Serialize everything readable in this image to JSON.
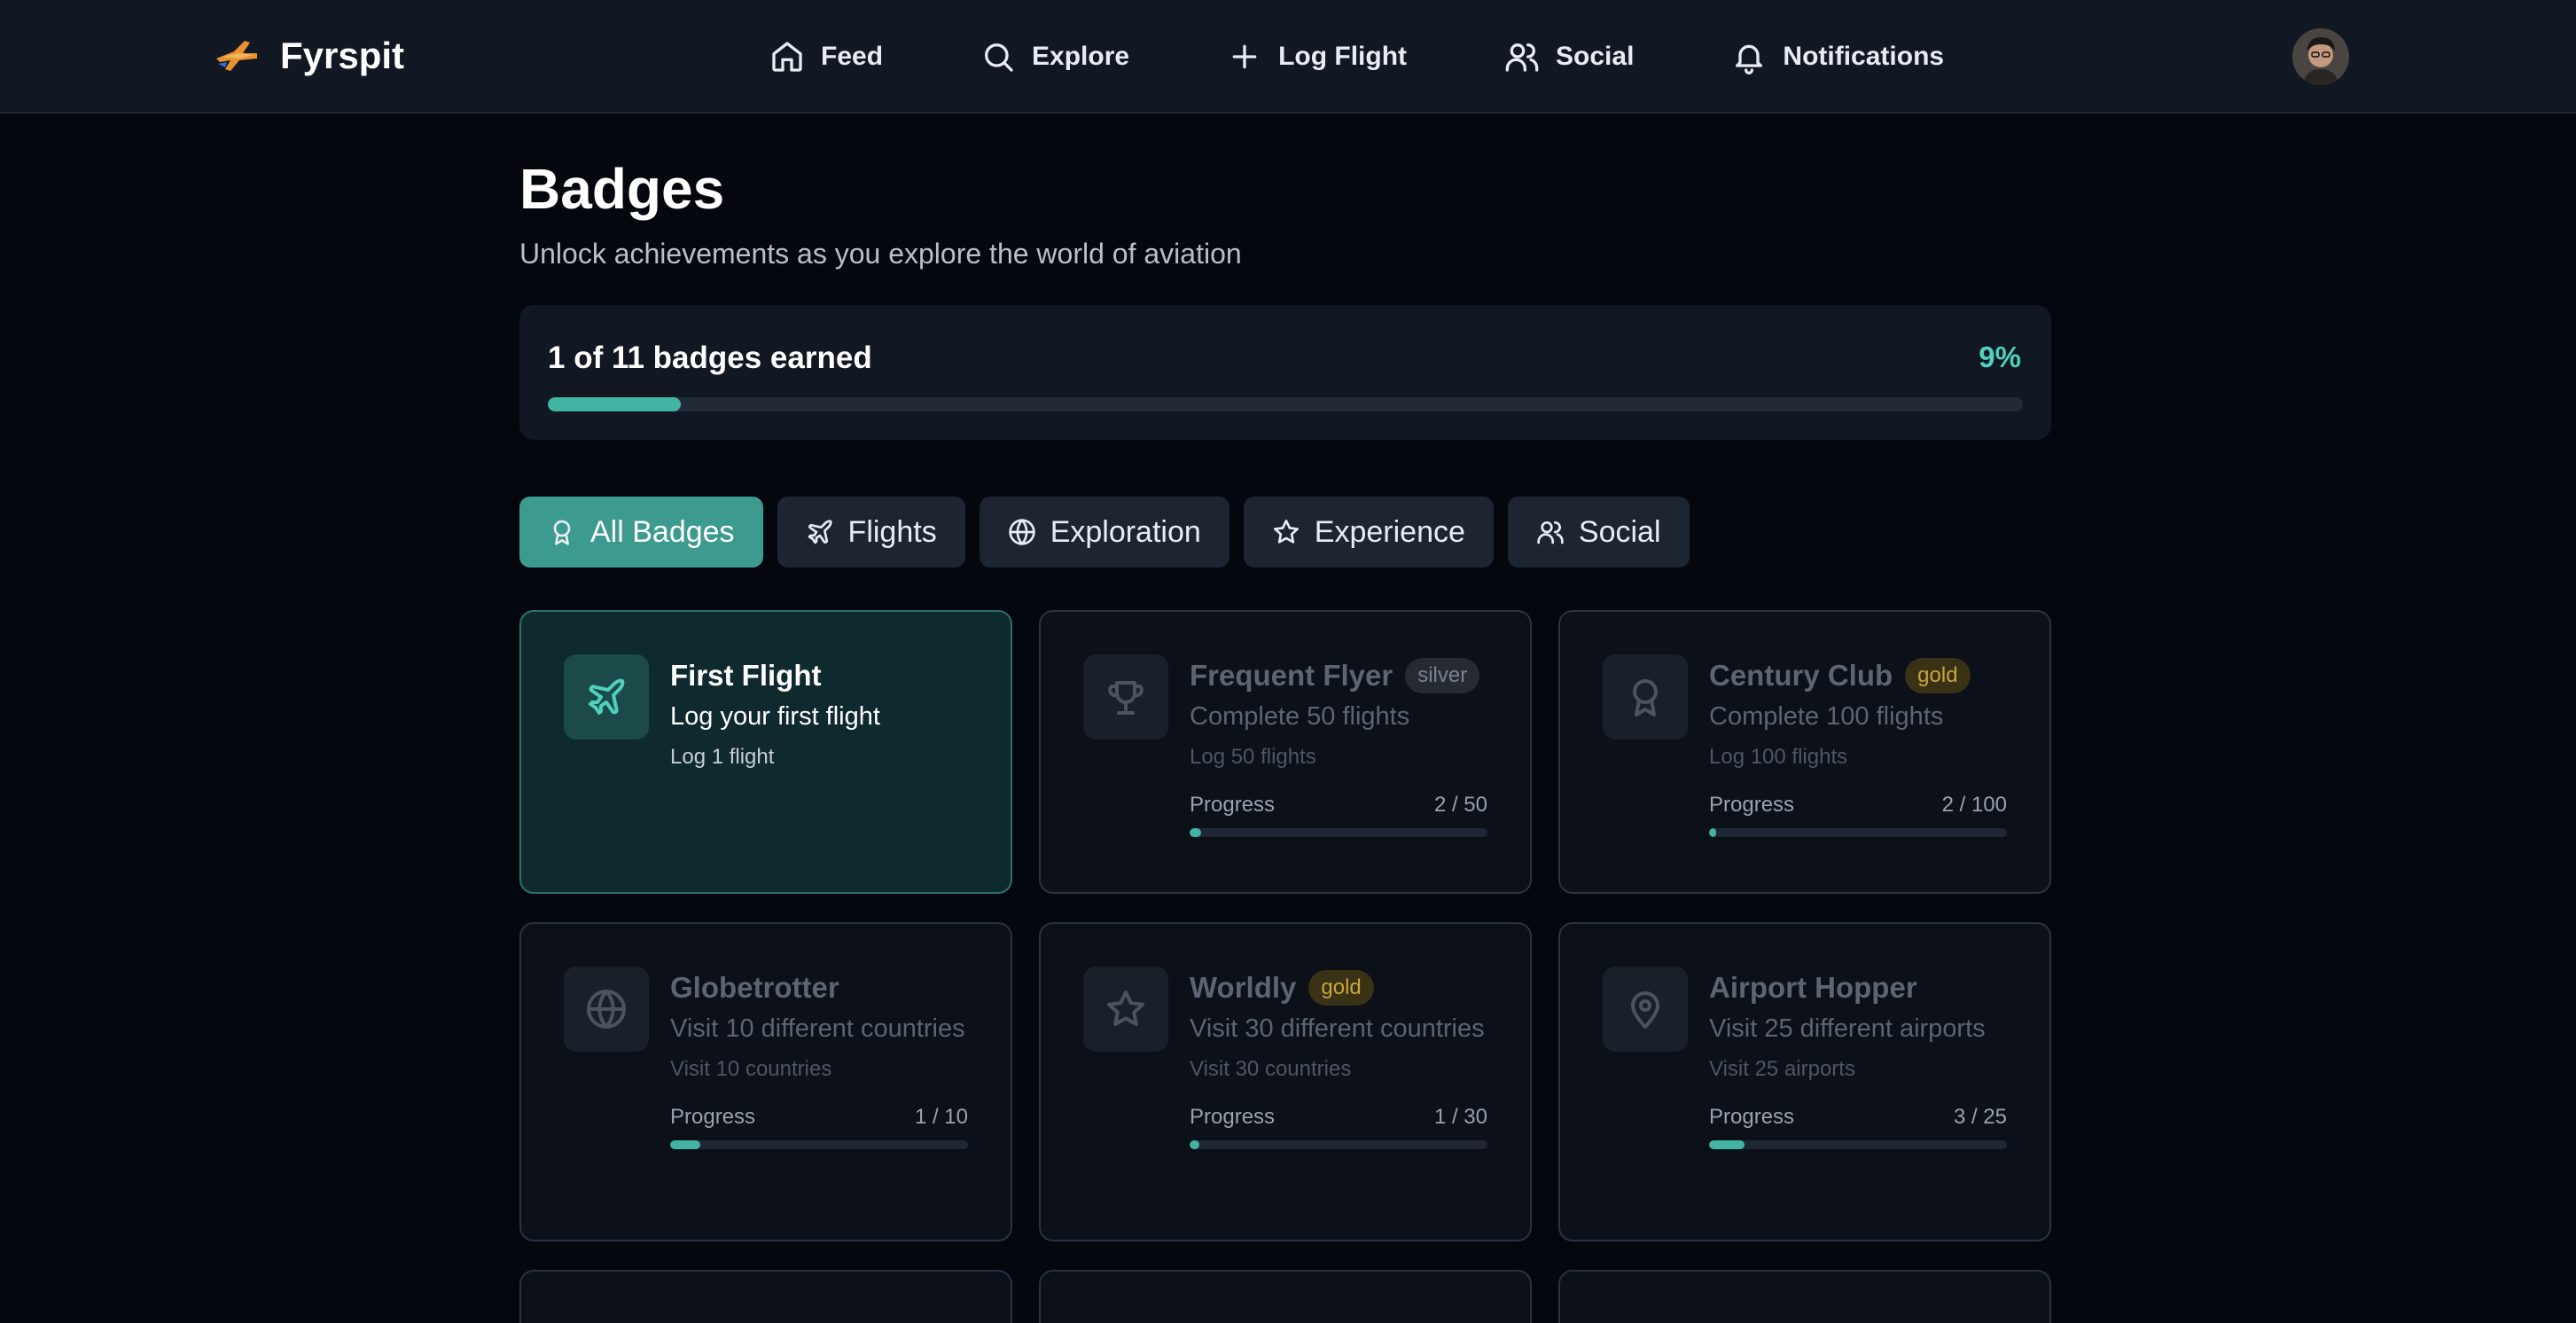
{
  "app": {
    "name": "Fyrspit"
  },
  "nav": [
    {
      "label": "Feed",
      "icon": "home-icon"
    },
    {
      "label": "Explore",
      "icon": "search-icon"
    },
    {
      "label": "Log Flight",
      "icon": "plus-icon"
    },
    {
      "label": "Social",
      "icon": "users-icon"
    },
    {
      "label": "Notifications",
      "icon": "bell-icon"
    }
  ],
  "header": {
    "title": "Badges",
    "subtitle": "Unlock achievements as you explore the world of aviation"
  },
  "summary": {
    "label": "1 of 11 badges earned",
    "percent_label": "9%",
    "progress_fraction": 0.09
  },
  "tabs": [
    {
      "label": "All Badges",
      "icon": "award-icon",
      "active": true
    },
    {
      "label": "Flights",
      "icon": "plane-icon",
      "active": false
    },
    {
      "label": "Exploration",
      "icon": "globe-icon",
      "active": false
    },
    {
      "label": "Experience",
      "icon": "star-icon",
      "active": false
    },
    {
      "label": "Social",
      "icon": "users-icon",
      "active": false
    }
  ],
  "badges": [
    {
      "name": "First Flight",
      "tier": "",
      "description": "Log your first flight",
      "requirement": "Log 1 flight",
      "earned": true,
      "icon": "plane-icon",
      "progress_label": "",
      "progress_value": "",
      "progress_fraction": 1
    },
    {
      "name": "Frequent Flyer",
      "tier": "silver",
      "description": "Complete 50 flights",
      "requirement": "Log 50 flights",
      "earned": false,
      "icon": "trophy-icon",
      "progress_label": "Progress",
      "progress_value": "2 / 50",
      "progress_fraction": 0.04
    },
    {
      "name": "Century Club",
      "tier": "gold",
      "description": "Complete 100 flights",
      "requirement": "Log 100 flights",
      "earned": false,
      "icon": "award-icon",
      "progress_label": "Progress",
      "progress_value": "2 / 100",
      "progress_fraction": 0.02
    },
    {
      "name": "Globetrotter",
      "tier": "",
      "description": "Visit 10 different countries",
      "requirement": "Visit 10 countries",
      "earned": false,
      "icon": "globe-icon",
      "progress_label": "Progress",
      "progress_value": "1 / 10",
      "progress_fraction": 0.1
    },
    {
      "name": "Worldly",
      "tier": "gold",
      "description": "Visit 30 different countries",
      "requirement": "Visit 30 countries",
      "earned": false,
      "icon": "star-icon",
      "progress_label": "Progress",
      "progress_value": "1 / 30",
      "progress_fraction": 0.033
    },
    {
      "name": "Airport Hopper",
      "tier": "",
      "description": "Visit 25 different airports",
      "requirement": "Visit 25 airports",
      "earned": false,
      "icon": "map-pin-icon",
      "progress_label": "Progress",
      "progress_value": "3 / 25",
      "progress_fraction": 0.12
    }
  ],
  "colors": {
    "accent": "#43b3a3",
    "accent_text": "#4fd1bd",
    "gold": "#c9a53a"
  }
}
